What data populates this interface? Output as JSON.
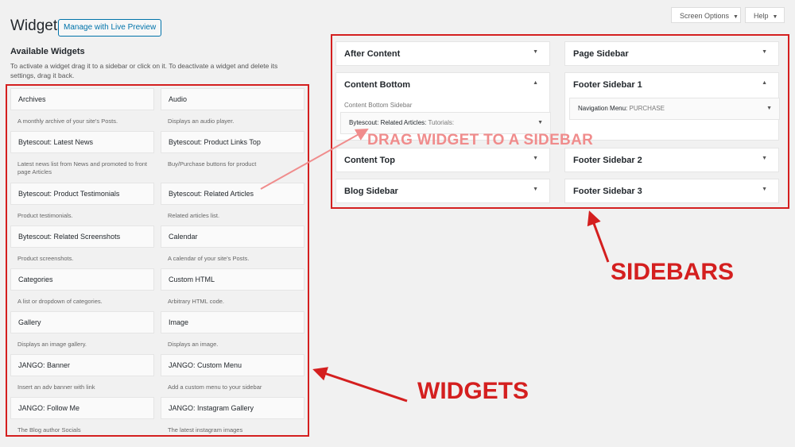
{
  "header": {
    "title": "Widgets",
    "live_preview_button": "Manage with Live Preview",
    "screen_options": "Screen Options",
    "help": "Help"
  },
  "available": {
    "heading": "Available Widgets",
    "description": "To activate a widget drag it to a sidebar or click on it. To deactivate a widget and delete its settings, drag it back."
  },
  "widgets": [
    {
      "name": "Archives",
      "desc": "A monthly archive of your site's Posts."
    },
    {
      "name": "Audio",
      "desc": "Displays an audio player."
    },
    {
      "name": "Bytescout: Latest News",
      "desc": "Latest news list from News and promoted to front page Articles"
    },
    {
      "name": "Bytescout: Product Links Top",
      "desc": "Buy/Purchase buttons for product"
    },
    {
      "name": "Bytescout: Product Testimonials",
      "desc": "Product testimonials."
    },
    {
      "name": "Bytescout: Related Articles",
      "desc": "Related articles list."
    },
    {
      "name": "Bytescout: Related Screenshots",
      "desc": "Product screenshots."
    },
    {
      "name": "Calendar",
      "desc": "A calendar of your site's Posts."
    },
    {
      "name": "Categories",
      "desc": "A list or dropdown of categories."
    },
    {
      "name": "Custom HTML",
      "desc": "Arbitrary HTML code."
    },
    {
      "name": "Gallery",
      "desc": "Displays an image gallery."
    },
    {
      "name": "Image",
      "desc": "Displays an image."
    },
    {
      "name": "JANGO: Banner",
      "desc": "Insert an adv banner with link"
    },
    {
      "name": "JANGO: Custom Menu",
      "desc": "Add a custom menu to your sidebar"
    },
    {
      "name": "JANGO: Follow Me",
      "desc": "The Blog author Socials"
    },
    {
      "name": "JANGO: Instagram Gallery",
      "desc": "The latest instagram images"
    }
  ],
  "sidebars": {
    "after_content": "After Content",
    "page_sidebar": "Page Sidebar",
    "content_bottom": "Content Bottom",
    "content_bottom_desc": "Content Bottom Sidebar",
    "content_bottom_widget": "Bytescout: Related Articles:",
    "content_bottom_widget_sub": "Tutorials:",
    "footer_sidebar_1": "Footer Sidebar 1",
    "footer_1_widget": "Navigation Menu:",
    "footer_1_widget_sub": "PURCHASE",
    "content_top": "Content Top",
    "footer_sidebar_2": "Footer Sidebar 2",
    "blog_sidebar": "Blog Sidebar",
    "footer_sidebar_3": "Footer Sidebar 3"
  },
  "annotations": {
    "drag": "DRAG WIDGET TO A SIDEBAR",
    "sidebars": "SIDEBARS",
    "widgets": "WIDGETS"
  },
  "icons": {
    "collapse": "chevron-down-icon",
    "expand": "chevron-up-icon"
  },
  "colors": {
    "annotation_red": "#d41f1f",
    "link_blue": "#0073aa"
  }
}
